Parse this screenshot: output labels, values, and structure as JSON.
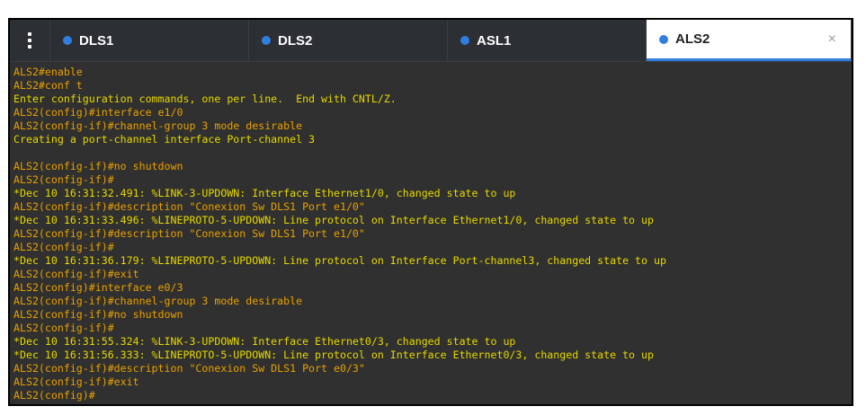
{
  "colors": {
    "tab_dot": "#2f7fe0",
    "active_indicator": "#2f7fe0",
    "prompt_text": "#e8a000",
    "info_text": "#e6d800",
    "console_bg": "#303030",
    "tabbar_bg": "#2c2f33"
  },
  "toolbar": {
    "menu_icon": "vertical-dots-icon"
  },
  "tabs": [
    {
      "label": "DLS1",
      "active": false
    },
    {
      "label": "DLS2",
      "active": false
    },
    {
      "label": "ASL1",
      "active": false
    },
    {
      "label": "ALS2",
      "active": true,
      "close_glyph": "×"
    }
  ],
  "console": {
    "lines": [
      {
        "text": "ALS2#enable",
        "kind": "prompt"
      },
      {
        "text": "ALS2#conf t",
        "kind": "prompt"
      },
      {
        "text": "Enter configuration commands, one per line.  End with CNTL/Z.",
        "kind": "info"
      },
      {
        "text": "ALS2(config)#interface e1/0",
        "kind": "prompt"
      },
      {
        "text": "ALS2(config-if)#channel-group 3 mode desirable",
        "kind": "prompt"
      },
      {
        "text": "Creating a port-channel interface Port-channel 3",
        "kind": "info"
      },
      {
        "text": "",
        "kind": "blank"
      },
      {
        "text": "ALS2(config-if)#no shutdown",
        "kind": "prompt"
      },
      {
        "text": "ALS2(config-if)#",
        "kind": "prompt"
      },
      {
        "text": "*Dec 10 16:31:32.491: %LINK-3-UPDOWN: Interface Ethernet1/0, changed state to up",
        "kind": "info"
      },
      {
        "text": "ALS2(config-if)#description \"Conexion Sw DLS1 Port e1/0\"",
        "kind": "prompt"
      },
      {
        "text": "*Dec 10 16:31:33.496: %LINEPROTO-5-UPDOWN: Line protocol on Interface Ethernet1/0, changed state to up",
        "kind": "info"
      },
      {
        "text": "ALS2(config-if)#description \"Conexion Sw DLS1 Port e1/0\"",
        "kind": "prompt"
      },
      {
        "text": "ALS2(config-if)#",
        "kind": "prompt"
      },
      {
        "text": "*Dec 10 16:31:36.179: %LINEPROTO-5-UPDOWN: Line protocol on Interface Port-channel3, changed state to up",
        "kind": "info"
      },
      {
        "text": "ALS2(config-if)#exit",
        "kind": "prompt"
      },
      {
        "text": "ALS2(config)#interface e0/3",
        "kind": "prompt"
      },
      {
        "text": "ALS2(config-if)#channel-group 3 mode desirable",
        "kind": "prompt"
      },
      {
        "text": "ALS2(config-if)#no shutdown",
        "kind": "prompt"
      },
      {
        "text": "ALS2(config-if)#",
        "kind": "prompt"
      },
      {
        "text": "*Dec 10 16:31:55.324: %LINK-3-UPDOWN: Interface Ethernet0/3, changed state to up",
        "kind": "info"
      },
      {
        "text": "*Dec 10 16:31:56.333: %LINEPROTO-5-UPDOWN: Line protocol on Interface Ethernet0/3, changed state to up",
        "kind": "info"
      },
      {
        "text": "ALS2(config-if)#description \"Conexion Sw DLS1 Port e0/3\"",
        "kind": "prompt"
      },
      {
        "text": "ALS2(config-if)#exit",
        "kind": "prompt"
      },
      {
        "text": "ALS2(config)#",
        "kind": "prompt"
      }
    ]
  }
}
